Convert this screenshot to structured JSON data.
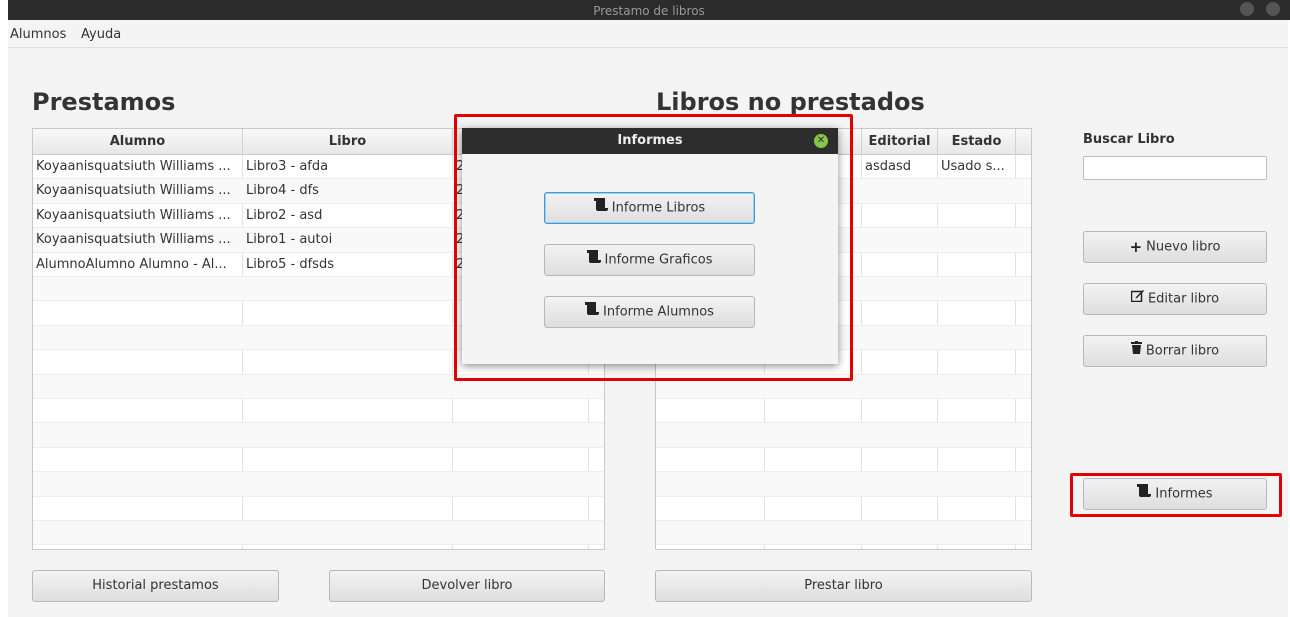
{
  "window": {
    "title": "Prestamo de libros"
  },
  "menu": {
    "items": [
      "Alumnos",
      "Ayuda"
    ]
  },
  "loans": {
    "heading": "Prestamos",
    "columns": [
      "Alumno",
      "Libro",
      ""
    ],
    "rows": [
      {
        "alumno": "Koyaanisquatsiuth Williams ...",
        "libro": "Libro3 - afda",
        "fecha": "2"
      },
      {
        "alumno": "Koyaanisquatsiuth Williams ...",
        "libro": "Libro4 - dfs",
        "fecha": "2"
      },
      {
        "alumno": "Koyaanisquatsiuth Williams ...",
        "libro": "Libro2 - asd",
        "fecha": "2"
      },
      {
        "alumno": "Koyaanisquatsiuth Williams ...",
        "libro": "Libro1 - autoi",
        "fecha": "2"
      },
      {
        "alumno": "AlumnoAlumno Alumno - Al...",
        "libro": "Libro5 - dfsds",
        "fecha": "2"
      }
    ],
    "history_button": "Historial prestamos",
    "return_button": "Devolver libro"
  },
  "books": {
    "heading": "Libros no prestados",
    "columns": [
      "",
      "",
      "Editorial",
      "Estado"
    ],
    "rows": [
      {
        "editorial": "asdasd",
        "estado": "Usado s..."
      }
    ],
    "lend_button": "Prestar libro"
  },
  "sidebar": {
    "search_label": "Buscar Libro",
    "search_value": "",
    "new_button": "Nuevo libro",
    "edit_button": "Editar libro",
    "delete_button": "Borrar libro",
    "reports_button": "Informes"
  },
  "dialog": {
    "title": "Informes",
    "buttons": [
      "Informe Libros",
      "Informe Graficos",
      "Informe Alumnos"
    ]
  },
  "colors": {
    "highlight": "#e00000",
    "dialog_title_bg": "#2d2d2d",
    "close_green": "#8bc34a"
  }
}
